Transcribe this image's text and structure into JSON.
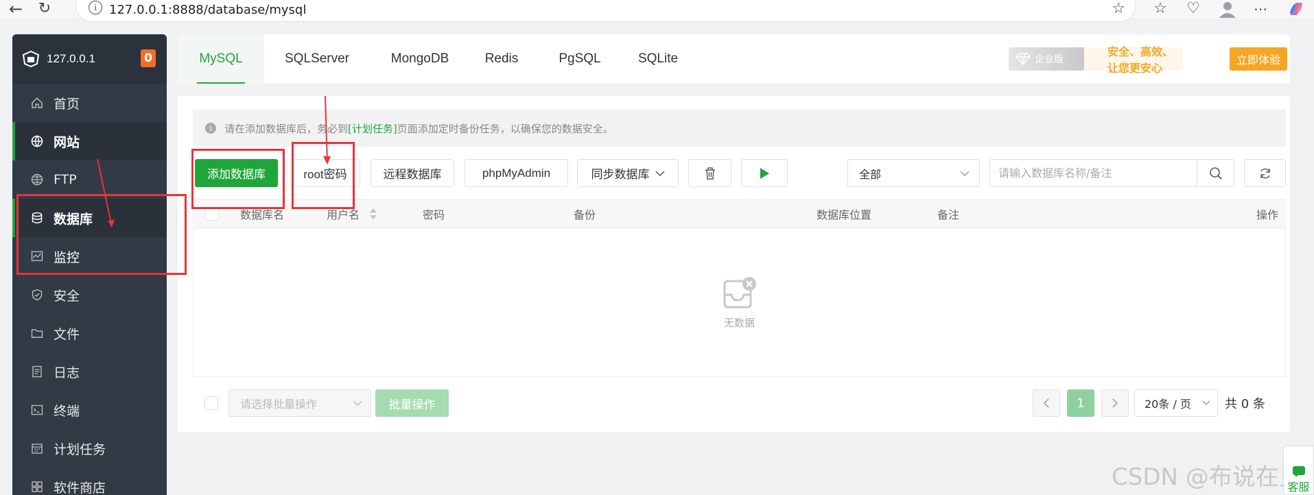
{
  "browser": {
    "url": "127.0.0.1:8888/database/mysql"
  },
  "sidebar": {
    "host": "127.0.0.1",
    "badge": "0",
    "items": [
      {
        "label": "首页",
        "icon": "home-icon"
      },
      {
        "label": "网站",
        "icon": "globe-icon"
      },
      {
        "label": "FTP",
        "icon": "globe-grid-icon"
      },
      {
        "label": "数据库",
        "icon": "database-icon"
      },
      {
        "label": "监控",
        "icon": "monitor-icon"
      },
      {
        "label": "安全",
        "icon": "shield-icon"
      },
      {
        "label": "文件",
        "icon": "folder-icon"
      },
      {
        "label": "日志",
        "icon": "log-icon"
      },
      {
        "label": "终端",
        "icon": "terminal-icon"
      },
      {
        "label": "计划任务",
        "icon": "calendar-icon"
      },
      {
        "label": "软件商店",
        "icon": "apps-icon"
      }
    ]
  },
  "tabs": [
    {
      "label": "MySQL"
    },
    {
      "label": "SQLServer"
    },
    {
      "label": "MongoDB"
    },
    {
      "label": "Redis"
    },
    {
      "label": "PgSQL"
    },
    {
      "label": "SQLite"
    }
  ],
  "enterprise": {
    "badge": "企业版",
    "slogan": "安全、高效、让您更安心",
    "button": "立即体验"
  },
  "notice": {
    "before": "请在添加数据库后，务必到",
    "link": "[计划任务]",
    "after": "页面添加定时备份任务，以确保您的数据安全。"
  },
  "toolbar": {
    "add_db": "添加数据库",
    "root_pwd": "root密码",
    "remote_db": "远程数据库",
    "phpmyadmin": "phpMyAdmin",
    "sync_db": "同步数据库",
    "filter": "全部",
    "search_placeholder": "请输入数据库名称/备注"
  },
  "table": {
    "columns": [
      "数据库名",
      "用户名",
      "密码",
      "备份",
      "数据库位置",
      "备注",
      "操作"
    ],
    "empty": "无数据"
  },
  "footer": {
    "batch_placeholder": "请选择批量操作",
    "batch_button": "批量操作",
    "page": "1",
    "page_size": "20条 / 页",
    "total": "共 0 条"
  },
  "watermark": "CSDN @布说在见",
  "float_tab": "客服",
  "colors": {
    "primary": "#20a53a",
    "sidebar": "#323a45",
    "annotation": "#e8333a",
    "enterprise": "#f5a623"
  }
}
